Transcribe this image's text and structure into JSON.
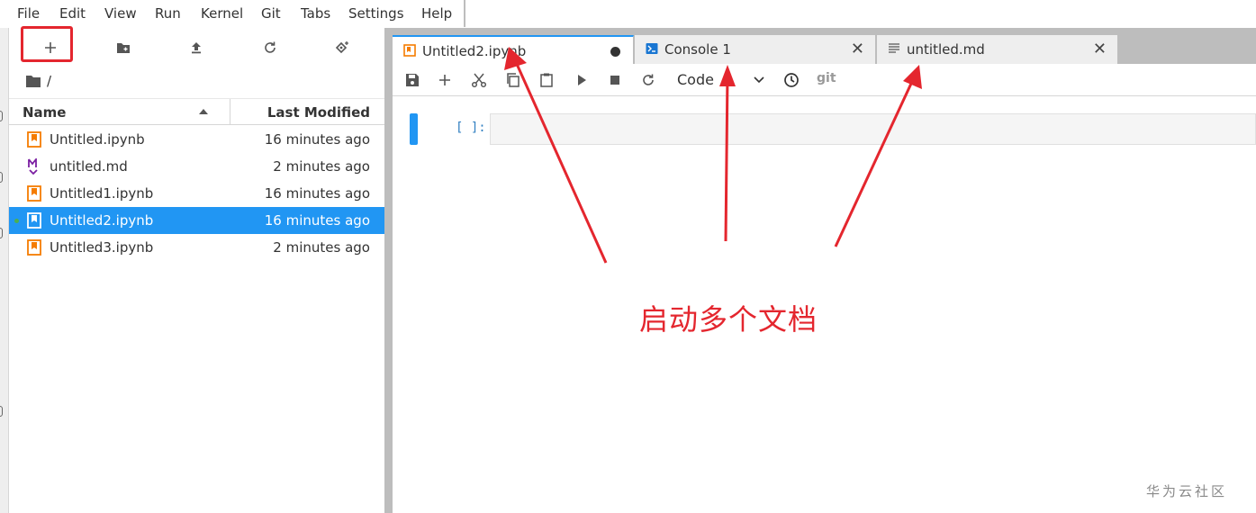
{
  "menu": {
    "items": [
      "File",
      "Edit",
      "View",
      "Run",
      "Kernel",
      "Git",
      "Tabs",
      "Settings",
      "Help"
    ]
  },
  "file_browser": {
    "toolbar_icons": [
      "plus-icon",
      "new-folder-icon",
      "upload-icon",
      "refresh-icon",
      "git-clone-icon"
    ],
    "breadcrumb": "/",
    "columns": {
      "name": "Name",
      "last_modified": "Last Modified",
      "sort": "ascending"
    },
    "files": [
      {
        "name": "Untitled.ipynb",
        "modified": "16 minutes ago",
        "type": "notebook",
        "selected": false,
        "running": false
      },
      {
        "name": "untitled.md",
        "modified": "2 minutes ago",
        "type": "markdown",
        "selected": false,
        "running": false
      },
      {
        "name": "Untitled1.ipynb",
        "modified": "16 minutes ago",
        "type": "notebook",
        "selected": false,
        "running": false
      },
      {
        "name": "Untitled2.ipynb",
        "modified": "16 minutes ago",
        "type": "notebook",
        "selected": true,
        "running": true
      },
      {
        "name": "Untitled3.ipynb",
        "modified": "2 minutes ago",
        "type": "notebook",
        "selected": false,
        "running": false
      }
    ]
  },
  "tabs": [
    {
      "label": "Untitled2.ipynb",
      "icon": "notebook-icon",
      "active": true,
      "unsaved": true
    },
    {
      "label": "Console 1",
      "icon": "console-icon",
      "active": false,
      "unsaved": false
    },
    {
      "label": "untitled.md",
      "icon": "text-file-icon",
      "active": false,
      "unsaved": false
    }
  ],
  "notebook_toolbar": {
    "cell_type": "Code",
    "git_label": "git"
  },
  "cell": {
    "prompt": "[ ]:",
    "source": ""
  },
  "annotation": {
    "text": "启动多个文档",
    "color": "#e4262e"
  },
  "watermark": "华为云社区",
  "colors": {
    "accent": "#2196f3",
    "selection": "#2196f3",
    "notebook_icon": "#f57c00",
    "markdown_icon": "#7b1fa2",
    "annotation_red": "#e4262e"
  }
}
